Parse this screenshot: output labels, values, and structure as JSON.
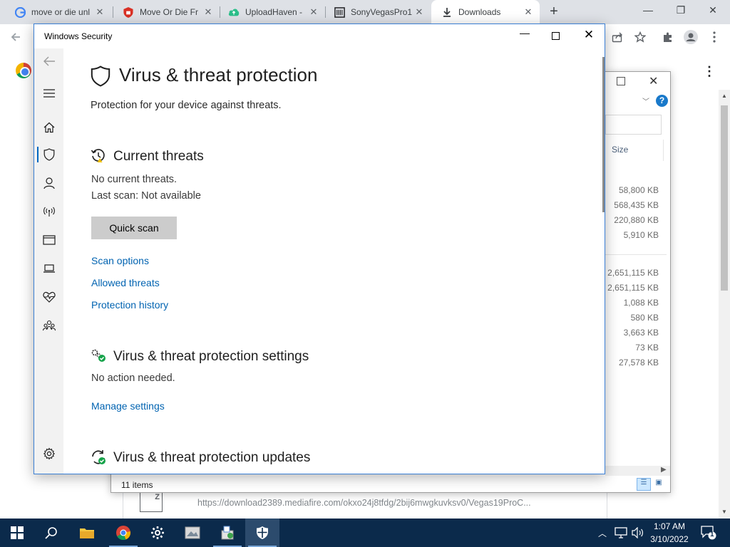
{
  "browser": {
    "tabs": [
      {
        "title": "move or die unl",
        "icon": "google-icon"
      },
      {
        "title": "Move Or Die Fr",
        "icon": "shield-red-icon"
      },
      {
        "title": "UploadHaven -",
        "icon": "cloud-upload-icon"
      },
      {
        "title": "SonyVegasPro1",
        "icon": "archive-icon"
      },
      {
        "title": "Downloads",
        "icon": "download-icon",
        "active": true
      }
    ],
    "new_tab_label": "+",
    "window_controls": {
      "minimize": "—",
      "restore": "❐",
      "close": "✕"
    },
    "download_url": "https://download2389.mediafire.com/okxo24j8tfdg/2bij6mwgkuvksv0/Vegas19ProC..."
  },
  "explorer": {
    "size_header": "Size",
    "sizes_group1": [
      "58,800 KB",
      "568,435 KB",
      "220,880 KB",
      "5,910 KB"
    ],
    "sizes_group2": [
      "2,651,115 KB",
      "2,651,115 KB",
      "1,088 KB",
      "580 KB",
      "3,663 KB",
      "73 KB",
      "27,578 KB"
    ],
    "status": "11 items",
    "help_label": "?"
  },
  "security": {
    "window_title": "Windows Security",
    "page_title": "Virus & threat protection",
    "page_subtitle": "Protection for your device against threats.",
    "current_threats": {
      "heading": "Current threats",
      "line1": "No current threats.",
      "line2": "Last scan: Not available",
      "button": "Quick scan",
      "links": [
        "Scan options",
        "Allowed threats",
        "Protection history"
      ]
    },
    "settings": {
      "heading": "Virus & threat protection settings",
      "status": "No action needed.",
      "link": "Manage settings"
    },
    "updates": {
      "heading": "Virus & threat protection updates"
    },
    "nav": [
      "back-arrow-icon",
      "hamburger-icon",
      "home-icon",
      "shield-icon",
      "account-icon",
      "wireless-icon",
      "app-browser-icon",
      "laptop-icon",
      "heart-pulse-icon",
      "family-icon",
      "settings-gear-icon"
    ]
  },
  "taskbar": {
    "time": "1:07 AM",
    "date": "3/10/2022",
    "notification_count": "1"
  }
}
